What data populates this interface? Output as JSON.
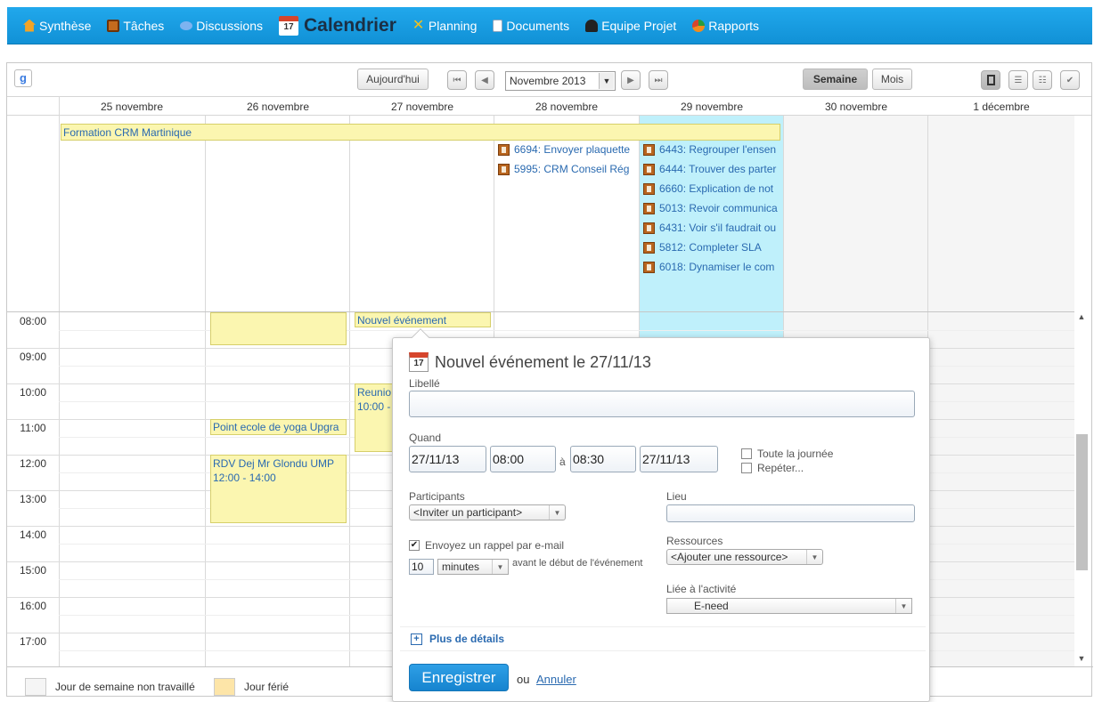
{
  "nav": {
    "items": [
      {
        "label": "Synthèse",
        "icon": "home-icon",
        "color": "#f2a427"
      },
      {
        "label": "Tâches",
        "icon": "task-icon",
        "color": "#c36b1e"
      },
      {
        "label": "Discussions",
        "icon": "chat-bubble-icon",
        "color": "#7db3f0"
      },
      {
        "label": "Calendrier",
        "icon": "calendar-icon",
        "color": "#d6452c"
      },
      {
        "label": "Planning",
        "icon": "planning-tools-icon",
        "color": "#f0c020"
      },
      {
        "label": "Documents",
        "icon": "document-icon",
        "color": "#ffffff"
      },
      {
        "label": "Equipe Projet",
        "icon": "user-icon",
        "color": "#222222"
      },
      {
        "label": "Rapports",
        "icon": "pie-chart-icon",
        "color": "#f28c1c"
      }
    ]
  },
  "toolbar": {
    "today": "Aujourd'hui",
    "month_select": "Novembre 2013",
    "week": "Semaine",
    "month": "Mois"
  },
  "days": [
    "25 novembre",
    "26 novembre",
    "27 novembre",
    "28 novembre",
    "29 novembre",
    "30 novembre",
    "1 décembre"
  ],
  "allday_event": "Formation CRM Martinique",
  "tasks_28": [
    "6694: Envoyer plaquette",
    "5995: CRM Conseil Rég"
  ],
  "tasks_29": [
    "6443: Regrouper l'ensen",
    "6444: Trouver des parter",
    "6660: Explication de not",
    "5013: Revoir communica",
    "6431: Voir s'il faudrait ou",
    "5812: Completer SLA",
    "6018: Dynamiser le com"
  ],
  "hours": [
    "08:00",
    "09:00",
    "10:00",
    "11:00",
    "12:00",
    "13:00",
    "14:00",
    "15:00",
    "16:00",
    "17:00"
  ],
  "events": {
    "new_event": "Nouvel événement",
    "reunion": "Reunio",
    "reunion_time": "10:00 -",
    "yoga": "Point ecole de yoga Upgra",
    "rdv": "RDV Dej Mr Glondu UMP",
    "rdv_time": "12:00 - 14:00"
  },
  "popup": {
    "title": "Nouvel événement le 27/11/13",
    "libelle_label": "Libellé",
    "libelle_value": "",
    "quand_label": "Quand",
    "start_date": "27/11/13",
    "start_time": "08:00",
    "a": "à",
    "end_time": "08:30",
    "end_date": "27/11/13",
    "all_day": "Toute la journée",
    "repeat": "Repéter...",
    "participants_label": "Participants",
    "participants_select": "<Inviter un participant>",
    "lieu_label": "Lieu",
    "lieu_value": "",
    "reminder_label": "Envoyez un rappel par e-mail",
    "reminder_value": "10",
    "reminder_unit": "minutes",
    "reminder_suffix": "avant le début de l'événement",
    "ressources_label": "Ressources",
    "ressources_select": "<Ajouter une ressource>",
    "activity_label": "Liée à l'activité",
    "activity_value": "E-need",
    "more_details": "Plus de détails",
    "save": "Enregistrer",
    "or": "ou",
    "cancel": "Annuler"
  },
  "legend": {
    "non_worked": "Jour de semaine non travaillé",
    "holiday": "Jour férié"
  },
  "colors": {
    "nav_bg": "#1a9de2",
    "event_bg": "#fbf6b0",
    "today_col": "#bff0fb",
    "weekend_col": "#f4f4f4",
    "holiday_swatch": "#fde5a8",
    "link": "#2a6ab0"
  }
}
